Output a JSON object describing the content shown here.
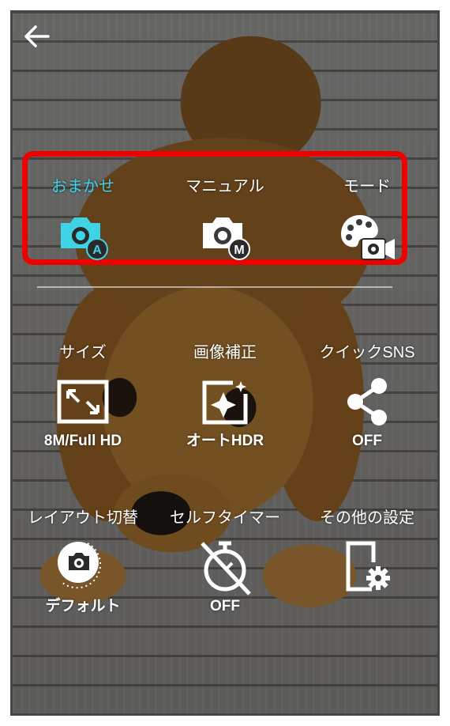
{
  "header": {
    "back_icon": "back-arrow-icon"
  },
  "modes": [
    {
      "label": "おまかせ",
      "icon": "camera-auto-icon",
      "color": "#3fd3e6"
    },
    {
      "label": "マニュアル",
      "icon": "camera-manual-icon",
      "color": "#ffffff"
    },
    {
      "label": "モード",
      "icon": "palette-video-icon",
      "color": "#ffffff"
    }
  ],
  "settings_row1": [
    {
      "label": "サイズ",
      "value": "8M/Full HD",
      "icon": "resize-icon"
    },
    {
      "label": "画像補正",
      "value": "オートHDR",
      "icon": "image-enhance-icon"
    },
    {
      "label": "クイックSNS",
      "value": "OFF",
      "icon": "share-icon"
    }
  ],
  "settings_row2": [
    {
      "label": "レイアウト切替",
      "value": "デフォルト",
      "icon": "layout-switch-icon"
    },
    {
      "label": "セルフタイマー",
      "value": "OFF",
      "icon": "timer-off-icon"
    },
    {
      "label": "その他の設定",
      "value": "",
      "icon": "other-settings-icon"
    }
  ],
  "highlight_color": "#ee0000"
}
